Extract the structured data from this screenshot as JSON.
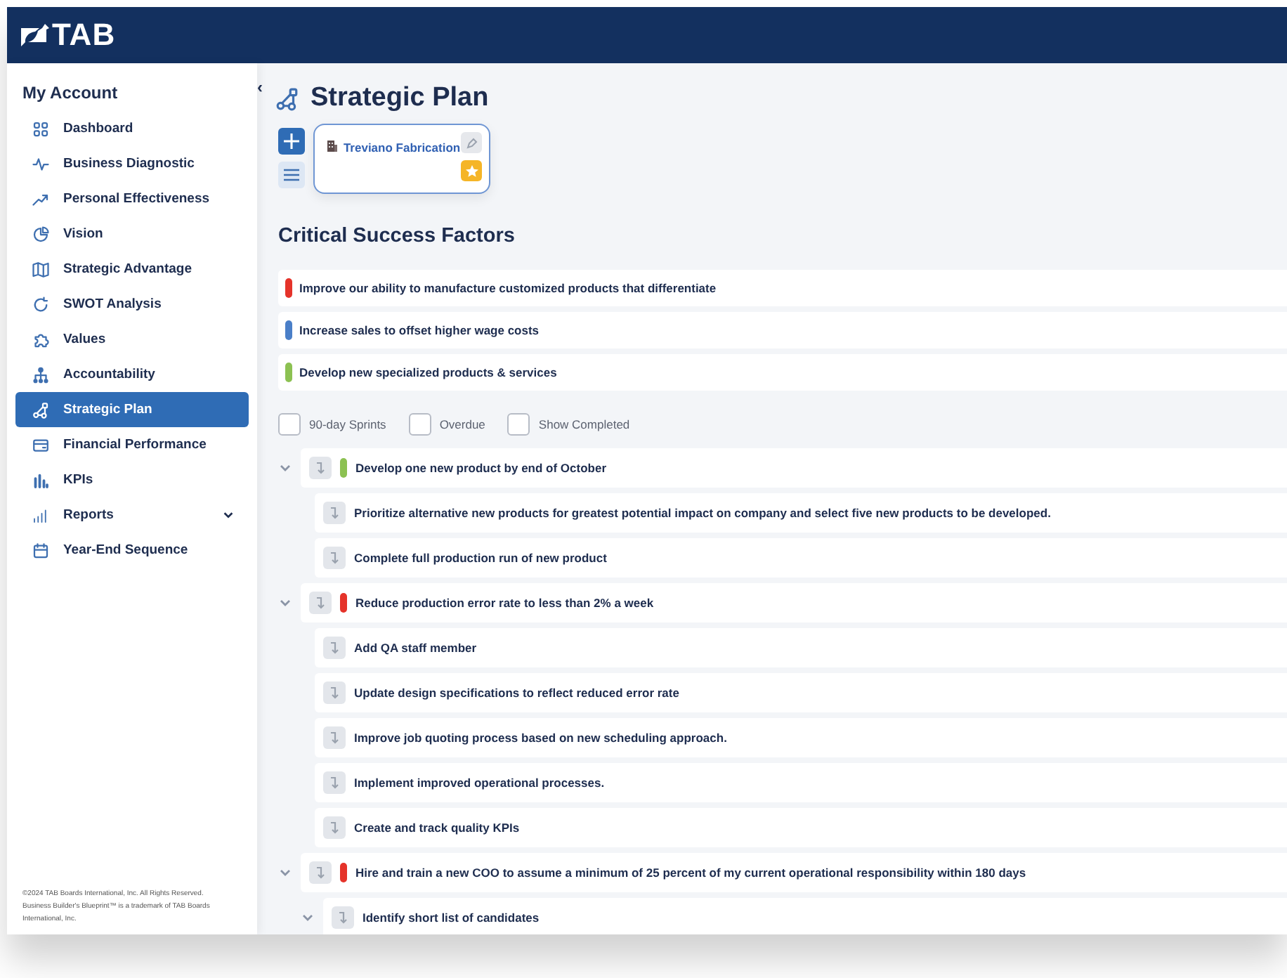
{
  "header": {
    "logo": "TAB"
  },
  "sidebar": {
    "title": "My Account",
    "collapse_glyph": "‹",
    "items": [
      {
        "label": "Dashboard",
        "selected": false,
        "kind": "link"
      },
      {
        "label": "Business Diagnostic",
        "selected": false,
        "kind": "link"
      },
      {
        "label": "Personal Effectiveness",
        "selected": false,
        "kind": "link"
      },
      {
        "label": "Vision",
        "selected": false,
        "kind": "link"
      },
      {
        "label": "Strategic Advantage",
        "selected": false,
        "kind": "link"
      },
      {
        "label": "SWOT Analysis",
        "selected": false,
        "kind": "link"
      },
      {
        "label": "Values",
        "selected": false,
        "kind": "link"
      },
      {
        "label": "Accountability",
        "selected": false,
        "kind": "link"
      },
      {
        "label": "Strategic Plan",
        "selected": true,
        "kind": "link"
      },
      {
        "label": "Financial Performance",
        "selected": false,
        "kind": "link"
      },
      {
        "label": "KPIs",
        "selected": false,
        "kind": "link"
      },
      {
        "label": "Reports",
        "selected": false,
        "kind": "group",
        "expanded": false
      },
      {
        "label": "Year-End Sequence",
        "selected": false,
        "kind": "link"
      }
    ],
    "footer": [
      "©2024 TAB Boards International, Inc. All Rights Reserved.",
      "Business Builder's Blueprint™ is a trademark of TAB Boards International, Inc."
    ]
  },
  "page": {
    "title": "Strategic Plan",
    "company": {
      "name": "Treviano Fabrication",
      "favorite": true
    }
  },
  "csf": {
    "title": "Critical Success Factors",
    "items": [
      {
        "text": "Improve our ability to manufacture customized products that differentiate",
        "color": "#e5332a"
      },
      {
        "text": "Increase sales to offset higher wage costs",
        "color": "#4a7fc8"
      },
      {
        "text": "Develop new specialized products & services",
        "color": "#8cc152"
      }
    ]
  },
  "filters": [
    {
      "label": "90-day Sprints",
      "checked": false
    },
    {
      "label": "Overdue",
      "checked": false
    },
    {
      "label": "Show Completed",
      "checked": false
    }
  ],
  "goals": [
    {
      "text": "Develop one new product by end of October",
      "color": "#8cc152",
      "expanded": true,
      "children": [
        {
          "text": "Prioritize alternative new products for greatest potential impact on company and select five new products to be developed.",
          "expanded": false
        },
        {
          "text": "Complete full production run of new product",
          "expanded": false
        }
      ]
    },
    {
      "text": "Reduce production error rate to less than 2% a week",
      "color": "#e5332a",
      "expanded": true,
      "children": [
        {
          "text": "Add QA staff member",
          "expanded": false
        },
        {
          "text": "Update design specifications to reflect reduced error rate",
          "expanded": false
        },
        {
          "text": "Improve job quoting process based on new scheduling approach.",
          "expanded": false
        },
        {
          "text": "Implement improved operational processes.",
          "expanded": false
        },
        {
          "text": "Create and track quality KPIs",
          "expanded": false
        }
      ]
    },
    {
      "text": "Hire and train a new COO to assume a minimum of 25 percent of my current operational responsibility within 180 days",
      "color": "#e5332a",
      "expanded": true,
      "children": [
        {
          "text": "Identify short list of candidates",
          "expanded": true
        }
      ]
    }
  ]
}
